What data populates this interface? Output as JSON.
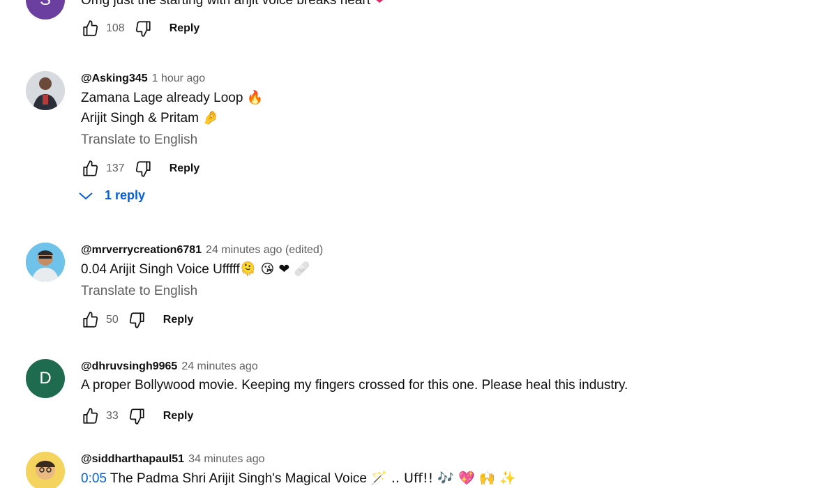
{
  "comments": [
    {
      "avatar_letter": "S",
      "avatar_color": "#6b3fa0",
      "text": "Omg just the starting with arijit voice breaks heart",
      "emoji": "❤",
      "likes": "108",
      "reply_label": "Reply"
    },
    {
      "author": "@Asking345",
      "time": "1 hour ago",
      "line1": "Zamana Lage already Loop",
      "line1_emoji": "🔥",
      "line2": "Arijit Singh & Pritam",
      "line2_emoji": "🤌",
      "translate": "Translate to English",
      "likes": "137",
      "reply_label": "Reply",
      "replies_label": "1 reply"
    },
    {
      "author": "@mrverrycreation6781",
      "time": "24 minutes ago (edited)",
      "text": "0.04 Arijit Singh Voice Ufffff",
      "emoji": "🫠 😘 ❤ 🩹",
      "translate": "Translate to English",
      "likes": "50",
      "reply_label": "Reply"
    },
    {
      "author": "@dhruvsingh9965",
      "time": "24 minutes ago",
      "avatar_letter": "D",
      "avatar_color": "#1e6b4f",
      "text": "A proper Bollywood movie. Keeping my fingers crossed for this one. Please heal this industry.",
      "likes": "33",
      "reply_label": "Reply"
    },
    {
      "author": "@siddharthapaul51",
      "time": "34 minutes ago",
      "timestamp": "0:05",
      "text": "The Padma Shri Arijit Singh's Magical Voice",
      "emoji": "🪄 .. Uff!! 🎶 💖 🙌 ✨"
    }
  ]
}
